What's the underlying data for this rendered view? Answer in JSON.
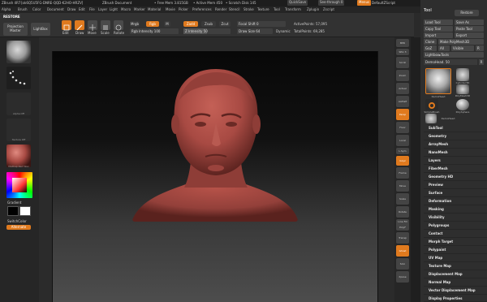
{
  "titlebar": {
    "app": "ZBrush 4R7",
    "doc_info": "[ok6Q5U5FG-DNRE-QQD-K2HO-HRZV]",
    "doc": "ZBrush Document",
    "free_mem": "• Free Mem 3.815GB",
    "active_mem": "• Active Mem 450",
    "scratch": "• Scratch Disk 145",
    "quicksave": "QuickSave",
    "seethrough": "See-through",
    "seethrough_val": "0",
    "menus_btn": "Menus",
    "script": "DefaultZScript"
  },
  "menubar": [
    "Alpha",
    "Brush",
    "Color",
    "Document",
    "Draw",
    "Edit",
    "File",
    "Layer",
    "Light",
    "Macro",
    "Marker",
    "Material",
    "Movie",
    "Picker",
    "Preferences",
    "Render",
    "Stencil",
    "Stroke",
    "Texture",
    "Tool",
    "Transform",
    "Zplugin",
    "Zscript"
  ],
  "toolbar": {
    "restore": "RESTORE",
    "projection_master": "Projection Master",
    "lightbox": "LightBox",
    "edit": "Edit",
    "draw": "Draw",
    "move": "Move",
    "scale": "Scale",
    "rotate": "Rotate",
    "mrgb": "Mrgb",
    "rgb": "Rgb",
    "m": "M",
    "zadd": "Zadd",
    "zsub": "Zsub",
    "zcut": "Zcut",
    "rgb_intensity": "Rgb Intensity 100",
    "z_intensity": "Z Intensity 50",
    "focal_shift": "Focal Shift 0",
    "draw_size": "Draw Size 64",
    "dynamic": "Dynamic",
    "active_points": "ActivePoints: 57,095",
    "total_points": "TotalPoints: 69,285"
  },
  "lefttray": {
    "alpha_cap": "Alpha Off",
    "texture_cap": "Texture Off",
    "material_cap": "MatCap Red Wax",
    "gradient": "Gradient",
    "switch_color": "SwitchColor",
    "alternate": "Alternate"
  },
  "rightshelf": [
    "BPR",
    "SPix 3",
    "Scroll",
    "Zoom",
    "Actual",
    "AAHalf",
    "Persp",
    "Floor",
    "Local",
    "L.Sym",
    "Gxyz",
    "Frame",
    "Move",
    "Scale",
    "Rotate",
    "Line Fill PolyF",
    "Transp",
    "Ghost",
    "Solo",
    "Xpose"
  ],
  "tool": {
    "title": "Tool",
    "restore": "Restore",
    "load_tool": "Load Tool",
    "save_as": "Save As",
    "copy_tool": "Copy Tool",
    "paste_tool": "Paste Tool",
    "import": "Import",
    "export": "Export",
    "clone": "Clone",
    "make_polymesh": "Make PolyMesh3D",
    "goz": "GoZ",
    "all": "All",
    "visible": "Visible",
    "r": "R",
    "lightbox_tools": "Lightbox▸Tools",
    "current_tool": "DemoHead. 50",
    "thumbs": [
      "DemoHead",
      "Cylinder3D",
      "PolyMesh3D",
      "SimpleBrush",
      "PolySphere",
      "DemoHead"
    ],
    "subpalettes": [
      "SubTool",
      "Geometry",
      "ArrayMesh",
      "NanoMesh",
      "Layers",
      "FiberMesh",
      "Geometry HD",
      "Preview",
      "Surface",
      "Deformation",
      "Masking",
      "Visibility",
      "Polygroups",
      "Contact",
      "Morph Target",
      "Polypaint",
      "UV Map",
      "Texture Map",
      "Displacement Map",
      "Normal Map",
      "Vector Displacement Map",
      "Display Properties"
    ]
  },
  "colors": {
    "accent": "#e07a1e",
    "clay": "#a84a43"
  }
}
